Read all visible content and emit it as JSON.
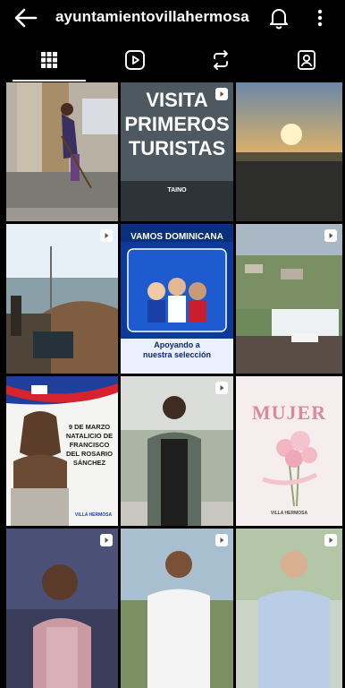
{
  "header": {
    "username": "ayuntamientovillahermosa",
    "icons": [
      "back-arrow-icon",
      "bell-icon",
      "more-vertical-icon"
    ]
  },
  "tabs": [
    {
      "name": "grid",
      "icon": "grid-icon",
      "active": true
    },
    {
      "name": "reels",
      "icon": "reels-icon",
      "active": false
    },
    {
      "name": "reposts",
      "icon": "repost-icon",
      "active": false
    },
    {
      "name": "tagged",
      "icon": "tagged-person-icon",
      "active": false
    }
  ],
  "posts": {
    "p2": {
      "line1": "VISITA",
      "line2": "PRIMEROS",
      "line3": "TURISTAS",
      "logo": "TAINO"
    },
    "p5": {
      "headline": "VAMOS DOMINICANA",
      "footer1": "Apoyando a",
      "footer2": "nuestra selección"
    },
    "p7": {
      "line1": "9 DE MARZO",
      "line2": "NATALICIO DE",
      "line3": "FRANCISCO",
      "line4": "DEL ROSARIO",
      "line5": "SÁNCHEZ",
      "brand": "VILLA HERMOSA"
    },
    "p9": {
      "title": "MUJER",
      "brand": "VILLA HERMOSA"
    }
  },
  "colors": {
    "background": "#000000",
    "text": "#ffffff",
    "divider": "#262626"
  }
}
